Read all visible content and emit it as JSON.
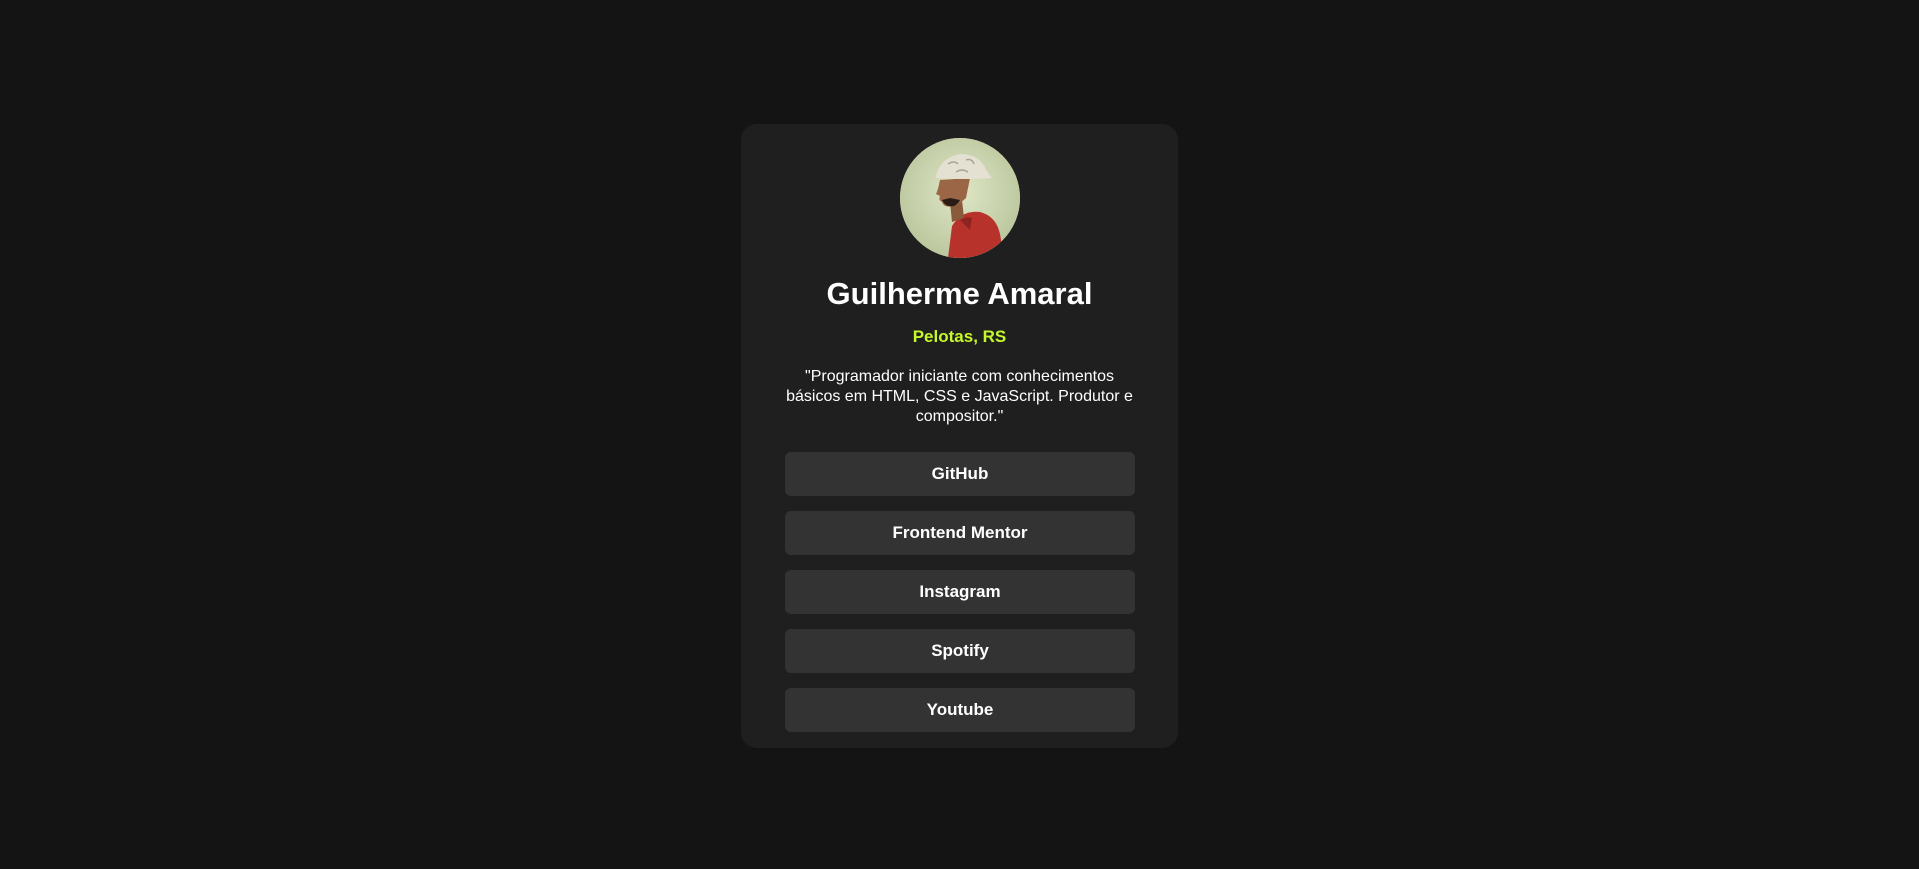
{
  "profile": {
    "name": "Guilherme Amaral",
    "location": "Pelotas, RS",
    "bio": "\"Programador iniciante com conhecimentos básicos em HTML, CSS e JavaScript. Produtor e compositor.\""
  },
  "links": [
    {
      "label": "GitHub"
    },
    {
      "label": "Frontend Mentor"
    },
    {
      "label": "Instagram"
    },
    {
      "label": "Spotify"
    },
    {
      "label": "Youtube"
    }
  ],
  "colors": {
    "page_background": "#141414",
    "card_background": "#1f1f1f",
    "button_background": "#333333",
    "accent": "#c4f82a",
    "text": "#ffffff"
  }
}
